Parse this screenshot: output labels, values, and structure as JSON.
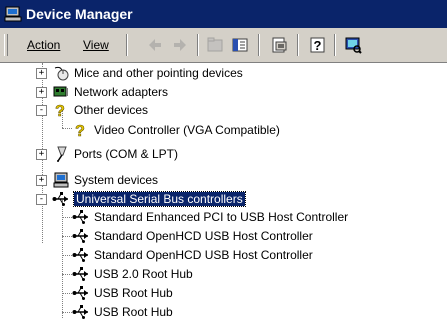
{
  "window": {
    "title": "Device Manager",
    "icon": "computer-icon"
  },
  "toolbar": {
    "menus": [
      {
        "label": "Action"
      },
      {
        "label": "View"
      }
    ],
    "buttons": [
      {
        "name": "back-arrow-icon",
        "enabled": false
      },
      {
        "name": "forward-arrow-icon",
        "enabled": false
      },
      {
        "name": "up-folder-icon",
        "enabled": false
      },
      {
        "name": "show-hide-tree-icon",
        "enabled": true
      },
      {
        "name": "properties-icon",
        "enabled": true
      },
      {
        "name": "help-icon",
        "enabled": true
      },
      {
        "name": "scan-hardware-icon",
        "enabled": true
      }
    ]
  },
  "tree": {
    "items": [
      {
        "label": "Mice and other pointing devices",
        "expander": "+",
        "icon": "mouse-icon"
      },
      {
        "label": "Network adapters",
        "expander": "+",
        "icon": "network-card-icon"
      },
      {
        "label": "Other devices",
        "expander": "-",
        "icon": "question-mark-icon"
      },
      {
        "label": "Video Controller (VGA Compatible)",
        "expander": "",
        "icon": "question-mark-icon"
      },
      {
        "label": "Ports (COM & LPT)",
        "expander": "+",
        "icon": "port-icon"
      },
      {
        "label": "System devices",
        "expander": "+",
        "icon": "computer-icon"
      },
      {
        "label": "Universal Serial Bus controllers",
        "expander": "-",
        "icon": "usb-icon",
        "selected": true
      },
      {
        "label": "Standard Enhanced PCI to USB Host Controller",
        "expander": "",
        "icon": "usb-icon"
      },
      {
        "label": "Standard OpenHCD USB Host Controller",
        "expander": "",
        "icon": "usb-icon"
      },
      {
        "label": "Standard OpenHCD USB Host Controller",
        "expander": "",
        "icon": "usb-icon"
      },
      {
        "label": "USB 2.0 Root Hub",
        "expander": "",
        "icon": "usb-icon"
      },
      {
        "label": "USB Root Hub",
        "expander": "",
        "icon": "usb-icon"
      },
      {
        "label": "USB Root Hub",
        "expander": "",
        "icon": "usb-icon"
      }
    ]
  }
}
